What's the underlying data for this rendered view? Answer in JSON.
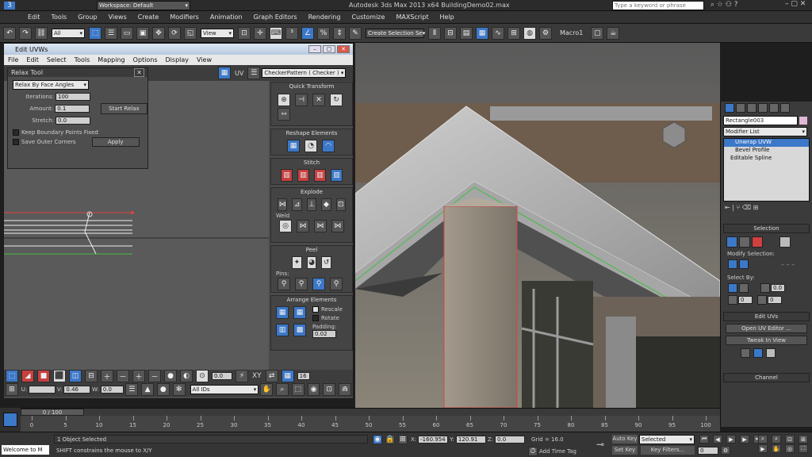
{
  "app": {
    "title": "Autodesk 3ds Max  2013 x64    BuildingDemo02.max",
    "workspace": "Workspace: Default",
    "search_placeholder": "Type a keyword or phrase"
  },
  "menu": [
    "Edit",
    "Tools",
    "Group",
    "Views",
    "Create",
    "Modifiers",
    "Animation",
    "Graph Editors",
    "Rendering",
    "Customize",
    "MAXScript",
    "Help"
  ],
  "toolbar": {
    "filter": "All",
    "refcoord": "View",
    "selset": "Create Selection Se",
    "macro": "Macro1"
  },
  "uvw": {
    "title": "Edit UVWs",
    "menu": [
      "File",
      "Edit",
      "Select",
      "Tools",
      "Mapping",
      "Options",
      "Display",
      "View"
    ],
    "uv_label": "UV",
    "texture": "CheckerPattern  ( Checker )",
    "relax": {
      "title": "Relax Tool",
      "mode": "Relax By Face Angles",
      "iterations_label": "Iterations:",
      "iterations": "100",
      "amount_label": "Amount:",
      "amount": "0.1",
      "stretch_label": "Stretch:",
      "stretch": "0.0",
      "keep_boundary": "Keep Boundary Points Fixed",
      "save_outer": "Save Outer Corners",
      "start_btn": "Start Relax",
      "apply_btn": "Apply"
    },
    "panels": {
      "quick_transform": "Quick Transform",
      "reshape": "Reshape Elements",
      "stitch": "Stitch",
      "explode": "Explode",
      "weld": "Weld",
      "peel": "Peel",
      "pins": "Pins:",
      "arrange": "Arrange Elements",
      "rescale": "Rescale",
      "rotate": "Rotate",
      "padding_label": "Padding:",
      "padding": "0.02"
    },
    "bottom": {
      "val1": "0.0",
      "xy": "XY",
      "val2": "16",
      "u_label": "U:",
      "u": "",
      "v_label": "V:",
      "v": "0.46",
      "w_label": "W:",
      "w": "0.0",
      "ids": "All IDs"
    }
  },
  "command": {
    "object": "Rectangle003",
    "modlist": "Modifier List",
    "stack": [
      "Unwrap UVW",
      "Bevel Profile",
      "Editable Spline"
    ],
    "selection": "Selection",
    "modify_selection": "Modify Selection:",
    "select_by": "Select By:",
    "sel_val1": "0.0",
    "sel_val2": "0",
    "edit_uvs": "Edit UVs",
    "open_editor": "Open UV Editor ...",
    "tweak": "Tweak In View",
    "channel": "Channel"
  },
  "timeline": {
    "frame": "0 / 100",
    "ticks": [
      "0",
      "5",
      "10",
      "15",
      "20",
      "25",
      "30",
      "35",
      "40",
      "45",
      "50",
      "55",
      "60",
      "65",
      "70",
      "75",
      "80",
      "85",
      "90",
      "95",
      "100"
    ]
  },
  "status": {
    "welcome": "Welcome to M",
    "selected": "1 Object Selected",
    "prompt": "SHIFT constrains the mouse to X/Y",
    "x_label": "X:",
    "x": "-160.954",
    "y_label": "Y:",
    "y": "120.91",
    "z_label": "Z:",
    "z": "0.0",
    "grid": "Grid = 16.0",
    "add_time_tag": "Add Time Tag",
    "auto_key": "Auto Key",
    "set_key": "Set Key",
    "key_mode": "Selected",
    "key_filters": "Key Filters...",
    "frame": "0"
  }
}
